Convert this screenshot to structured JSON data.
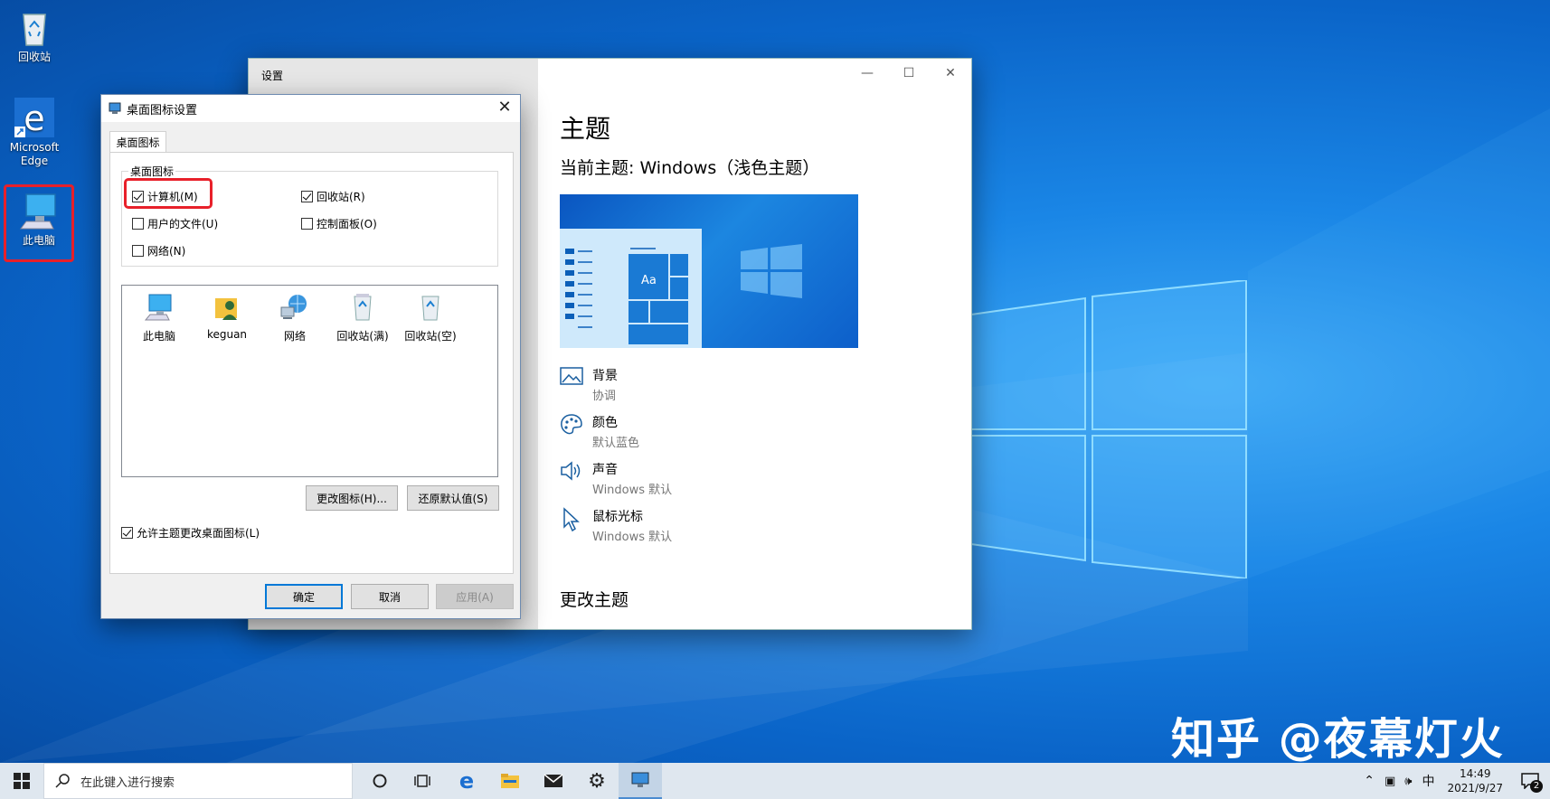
{
  "desktop": {
    "icons": [
      {
        "label": "回收站"
      },
      {
        "label": "Microsoft Edge"
      },
      {
        "label": "此电脑"
      }
    ]
  },
  "settings": {
    "window_title": "设置",
    "heading": "主题",
    "current_theme": "当前主题: Windows（浅色主题）",
    "preview_sample": "Aa",
    "items": [
      {
        "name": "背景",
        "value": "协调",
        "icon": "picture-icon"
      },
      {
        "name": "颜色",
        "value": "默认蓝色",
        "icon": "palette-icon"
      },
      {
        "name": "声音",
        "value": "Windows 默认",
        "icon": "speaker-icon"
      },
      {
        "name": "鼠标光标",
        "value": "Windows 默认",
        "icon": "cursor-icon"
      }
    ],
    "change_theme": "更改主题"
  },
  "dialog": {
    "title": "桌面图标设置",
    "tab": "桌面图标",
    "group_label": "桌面图标",
    "checkboxes": [
      {
        "label": "计算机(M)",
        "checked": true
      },
      {
        "label": "回收站(R)",
        "checked": true
      },
      {
        "label": "用户的文件(U)",
        "checked": false
      },
      {
        "label": "控制面板(O)",
        "checked": false
      },
      {
        "label": "网络(N)",
        "checked": false
      }
    ],
    "icon_list": [
      "此电脑",
      "keguan",
      "网络",
      "回收站(满)",
      "回收站(空)"
    ],
    "change_icon": "更改图标(H)...",
    "restore_default": "还原默认值(S)",
    "allow_theme": {
      "label": "允许主题更改桌面图标(L)",
      "checked": true
    },
    "ok": "确定",
    "cancel": "取消",
    "apply": "应用(A)"
  },
  "watermark": "知乎 @夜幕灯火",
  "taskbar": {
    "search_placeholder": "在此键入进行搜索",
    "ime": "中",
    "time": "14:49",
    "date": "2021/9/27",
    "notification_count": "2"
  }
}
